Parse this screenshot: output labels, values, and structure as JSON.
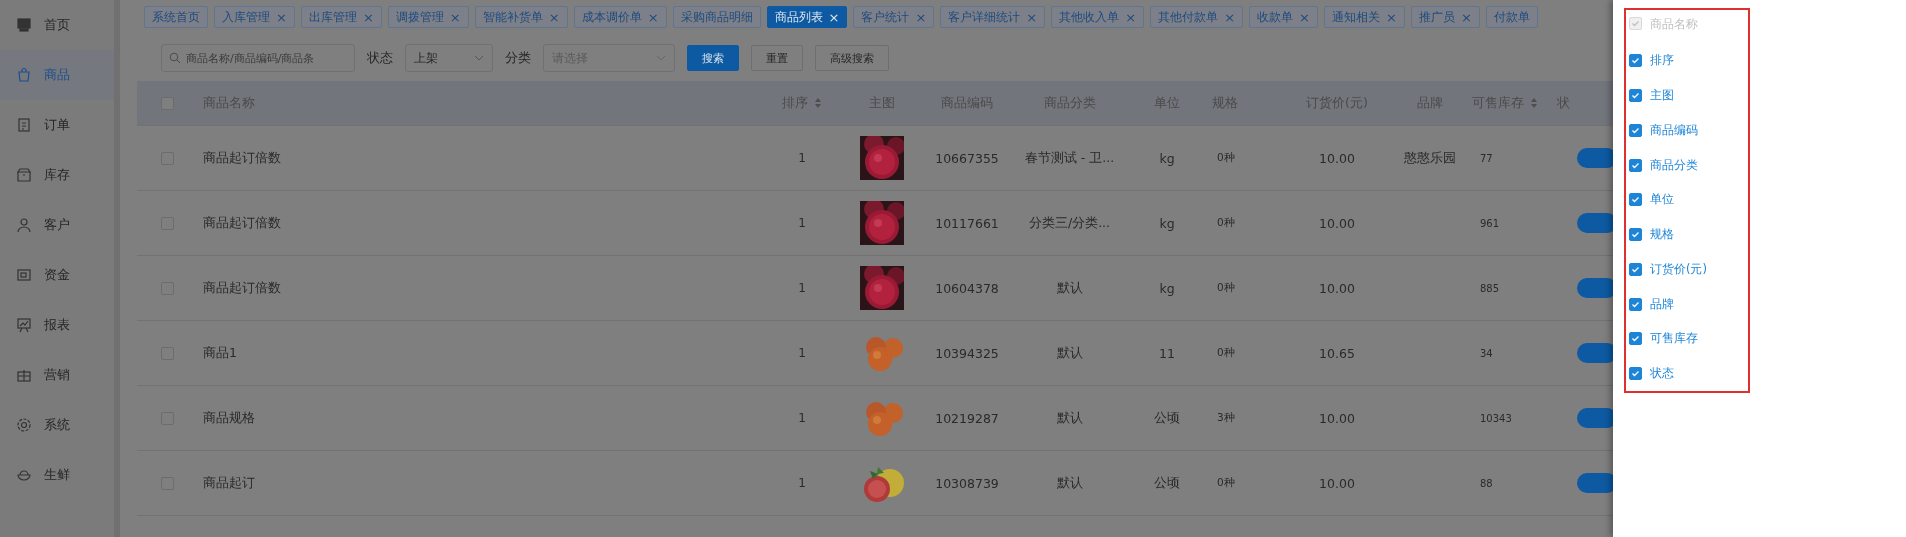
{
  "sidebar": {
    "items": [
      {
        "label": "首页",
        "selected": false
      },
      {
        "label": "商品",
        "selected": true
      },
      {
        "label": "订单",
        "selected": false
      },
      {
        "label": "库存",
        "selected": false
      },
      {
        "label": "客户",
        "selected": false
      },
      {
        "label": "资金",
        "selected": false
      },
      {
        "label": "报表",
        "selected": false
      },
      {
        "label": "营销",
        "selected": false
      },
      {
        "label": "系统",
        "selected": false
      },
      {
        "label": "生鲜",
        "selected": false
      }
    ]
  },
  "tabs": [
    {
      "label": "系统首页",
      "selected": false
    },
    {
      "label": "入库管理",
      "close": "×",
      "selected": false
    },
    {
      "label": "出库管理",
      "close": "×",
      "selected": false
    },
    {
      "label": "调拨管理",
      "close": "×",
      "selected": false
    },
    {
      "label": "智能补货单",
      "close": "×",
      "selected": false
    },
    {
      "label": "成本调价单",
      "close": "×",
      "selected": false
    },
    {
      "label": "采购商品明细",
      "selected": false
    },
    {
      "label": "商品列表",
      "close": "×",
      "selected": true
    },
    {
      "label": "客户统计",
      "close": "×",
      "selected": false
    },
    {
      "label": "客户详细统计",
      "close": "×",
      "selected": false
    },
    {
      "label": "其他收入单",
      "close": "×",
      "selected": false
    },
    {
      "label": "其他付款单",
      "close": "×",
      "selected": false
    },
    {
      "label": "收款单",
      "close": "×",
      "selected": false
    },
    {
      "label": "通知相关",
      "close": "×",
      "selected": false
    },
    {
      "label": "推广员",
      "close": "×",
      "selected": false
    },
    {
      "label": "付款单",
      "selected": false
    }
  ],
  "filters": {
    "search": {
      "placeholder": "商品名称/商品编码/商品条"
    },
    "status_label": "状态",
    "status_value": "上架",
    "category_label": "分类",
    "category_placeholder": "请选择",
    "buttons": [
      {
        "label": "搜索",
        "kind": "primary"
      },
      {
        "label": "重置",
        "kind": "plain"
      },
      {
        "label": "高级搜索",
        "kind": "plain"
      }
    ]
  },
  "table": {
    "select_all_checked": false,
    "columns": [
      {
        "label": "商品名称",
        "sortable": false
      },
      {
        "label": "排序",
        "sortable": true
      },
      {
        "label": "主图",
        "sortable": false
      },
      {
        "label": "商品编码",
        "sortable": false
      },
      {
        "label": "商品分类",
        "sortable": false
      },
      {
        "label": "单位",
        "sortable": false
      },
      {
        "label": "规格",
        "sortable": false
      },
      {
        "label": "订货价(元)",
        "sortable": false
      },
      {
        "label": "品牌",
        "sortable": false
      },
      {
        "label": "可售库存",
        "sortable": true
      },
      {
        "label": "状",
        "sortable": false
      }
    ],
    "rows": [
      {
        "checked": false,
        "name": "商品起订倍数",
        "sort": "1",
        "code": "10667355",
        "category": "春节测试 - 卫...",
        "unit": "kg",
        "spec": "0种",
        "price": "10.00",
        "brand": "憨憨乐园",
        "stock": "77",
        "on": true
      },
      {
        "checked": false,
        "name": "商品起订倍数",
        "sort": "1",
        "code": "10117661",
        "category": "分类三/分类...",
        "unit": "kg",
        "spec": "0种",
        "price": "10.00",
        "stock": "961",
        "on": true
      },
      {
        "checked": false,
        "name": "商品起订倍数",
        "sort": "1",
        "code": "10604378",
        "category": "默认",
        "unit": "kg",
        "spec": "0种",
        "price": "10.00",
        "stock": "885",
        "on": true
      },
      {
        "checked": false,
        "name": "商品1",
        "sort": "1",
        "code": "10394325",
        "category": "默认",
        "unit": "11",
        "spec": "0种",
        "price": "10.65",
        "stock": "34",
        "on": true
      },
      {
        "checked": false,
        "name": "商品规格",
        "sort": "1",
        "code": "10219287",
        "category": "默认",
        "unit": "公顷",
        "spec": "3种",
        "price": "10.00",
        "stock": "10343",
        "on": true
      },
      {
        "checked": false,
        "name": "商品起订",
        "sort": "1",
        "code": "10308739",
        "category": "默认",
        "unit": "公顷",
        "spec": "0种",
        "price": "10.00",
        "stock": "88",
        "on": true
      }
    ]
  },
  "column_panel": {
    "items": [
      {
        "label": "商品名称",
        "checked": true,
        "disabled": true
      },
      {
        "label": "排序",
        "checked": true,
        "disabled": false
      },
      {
        "label": "主图",
        "checked": true,
        "disabled": false
      },
      {
        "label": "商品编码",
        "checked": true,
        "disabled": false
      },
      {
        "label": "商品分类",
        "checked": true,
        "disabled": false
      },
      {
        "label": "单位",
        "checked": true,
        "disabled": false
      },
      {
        "label": "规格",
        "checked": true,
        "disabled": false
      },
      {
        "label": "订货价(元)",
        "checked": true,
        "disabled": false
      },
      {
        "label": "品牌",
        "checked": true,
        "disabled": false
      },
      {
        "label": "可售库存",
        "checked": true,
        "disabled": false
      },
      {
        "label": "状态",
        "checked": true,
        "disabled": false
      }
    ]
  }
}
